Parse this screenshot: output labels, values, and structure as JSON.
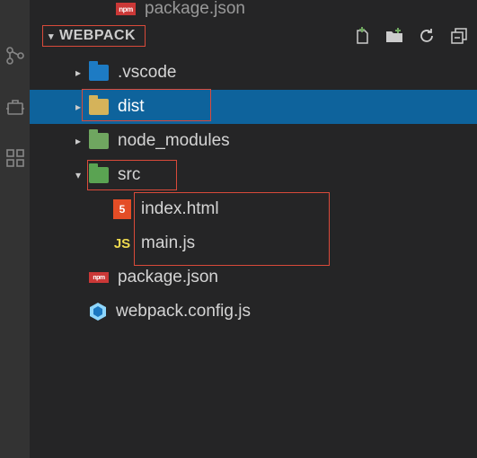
{
  "top_partial_file": "package.json",
  "section_title": "WEBPACK",
  "actions": {
    "new_file": "New File",
    "new_folder": "New Folder",
    "refresh": "Refresh",
    "collapse": "Collapse All"
  },
  "tree": {
    "vscode": ".vscode",
    "dist": "dist",
    "node_modules": "node_modules",
    "src": "src",
    "index_html": "index.html",
    "main_js": "main.js",
    "package_json": "package.json",
    "webpack_config": "webpack.config.js"
  }
}
